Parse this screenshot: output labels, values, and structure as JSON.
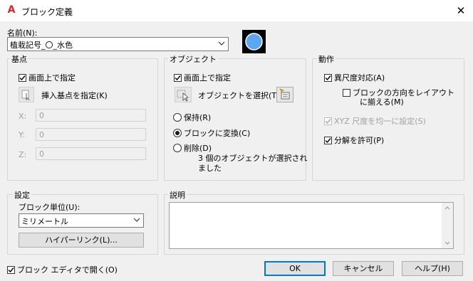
{
  "window": {
    "title": "ブロック定義",
    "app_icon": "autocad-a-icon",
    "close_glyph": "✕"
  },
  "name_section": {
    "label": "名前(N):",
    "value": "植栽記号_〇_水色"
  },
  "base_point": {
    "title": "基点",
    "specify_on_screen": "画面上で指定",
    "pick_button_label": "挿入基点を指定(K)",
    "x_label": "X:",
    "y_label": "Y:",
    "z_label": "Z:",
    "x_value": "0",
    "y_value": "0",
    "z_value": "0"
  },
  "objects": {
    "title": "オブジェクト",
    "specify_on_screen": "画面上で指定",
    "select_label": "オブジェクトを選択(T)",
    "retain": "保持(R)",
    "convert": "ブロックに変換(C)",
    "delete": "削除(D)",
    "status_line1": "3 個のオブジェクトが選択され",
    "status_line2": "ました"
  },
  "behavior": {
    "title": "動作",
    "annotative": "異尺度対応(A)",
    "match_orientation_line1": "ブロックの方向をレイアウト",
    "match_orientation_line2": "に揃える(M)",
    "uniform_scale": "XYZ 尺度を均一に設定(S)",
    "allow_explode": "分解を許可(P)"
  },
  "settings": {
    "title": "設定",
    "unit_label": "ブロック単位(U):",
    "unit_value": "ミリメートル",
    "hyperlink_button": "ハイパーリンク(L)..."
  },
  "description": {
    "title": "説明"
  },
  "footer": {
    "open_in_editor": "ブロック エディタで開く(O)",
    "ok": "OK",
    "cancel": "キャンセル",
    "help": "ヘルプ(H)"
  },
  "state": {
    "base_specify_on_screen": true,
    "objects_specify_on_screen": true,
    "objects_mode": "convert",
    "annotative": true,
    "match_orientation": false,
    "uniform_scale": true,
    "allow_explode": true,
    "open_in_editor": true
  },
  "colors": {
    "accent": "#0078d7",
    "preview_fill": "#5ea6f2",
    "app_red": "#d7282f"
  }
}
